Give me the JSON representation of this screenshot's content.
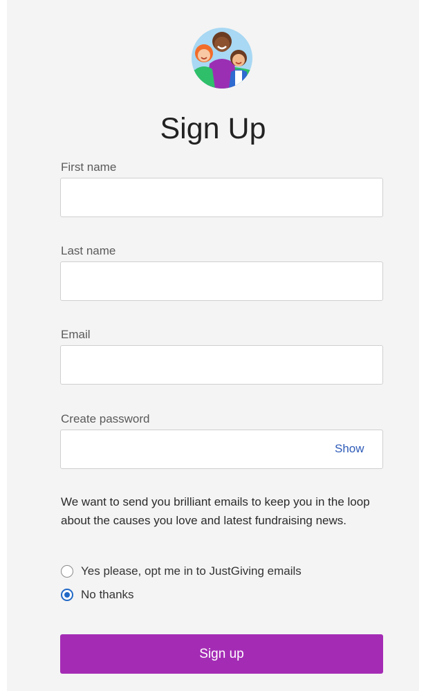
{
  "header": {
    "title": "Sign Up",
    "logo_icon": "people-group-icon"
  },
  "form": {
    "first_name": {
      "label": "First name",
      "value": "",
      "placeholder": ""
    },
    "last_name": {
      "label": "Last name",
      "value": "",
      "placeholder": ""
    },
    "email": {
      "label": "Email",
      "value": "",
      "placeholder": ""
    },
    "password": {
      "label": "Create password",
      "value": "",
      "placeholder": "",
      "toggle_label": "Show"
    }
  },
  "marketing": {
    "intro": "We want to send you brilliant emails to keep you in the loop about the causes you love and latest fundraising news.",
    "options": [
      {
        "label": "Yes please, opt me in to JustGiving emails",
        "selected": false
      },
      {
        "label": "No thanks",
        "selected": true
      }
    ]
  },
  "submit": {
    "label": "Sign up"
  },
  "colors": {
    "panel_background": "#f4f4f4",
    "primary_button": "#a42cb5",
    "link": "#2e5bb8",
    "radio_selected": "#2169c7"
  }
}
